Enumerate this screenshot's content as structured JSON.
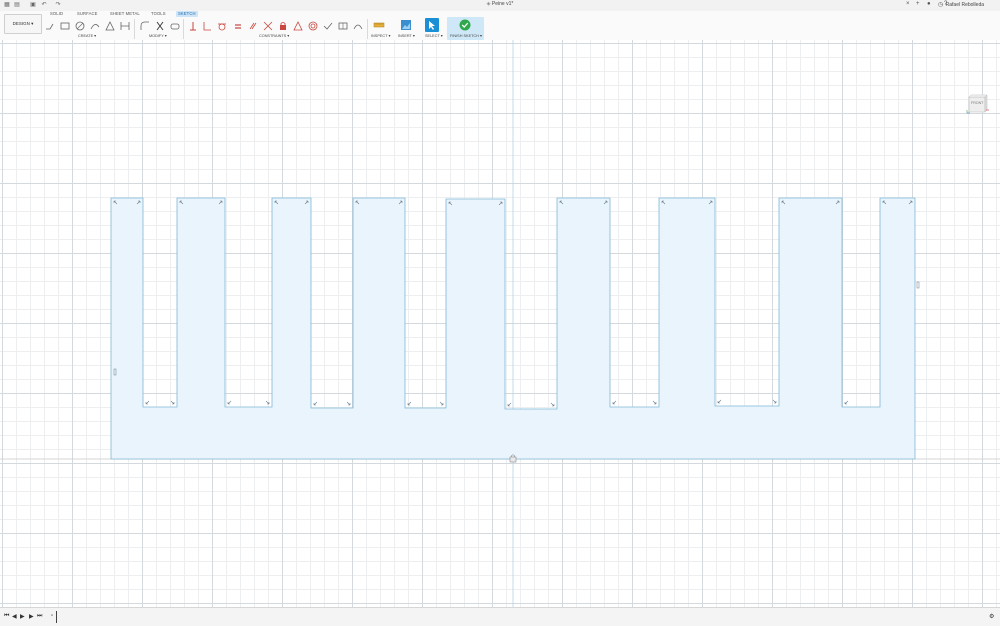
{
  "window": {
    "title": "Peine v1*"
  },
  "titlebar": {
    "user": "Rafael Rebolleda"
  },
  "toolbar": {
    "design_label": "DESIGN ▾",
    "tabs": [
      {
        "label": "SOLID"
      },
      {
        "label": "SURFACE"
      },
      {
        "label": "SHEET METAL"
      },
      {
        "label": "TOOLS"
      },
      {
        "label": "SKETCH"
      }
    ],
    "groups": {
      "create": "CREATE ▾",
      "modify": "MODIFY ▾",
      "constraints": "CONSTRAINTS ▾",
      "inspect": "INSPECT ▾",
      "insert": "INSERT ▾",
      "select": "SELECT ▾",
      "finish": "FINISH SKETCH ▾"
    }
  },
  "viewcube": {
    "face": "FRONT"
  },
  "colors": {
    "sketch_fill": "#eaf4fc",
    "sketch_line": "#7fb8d8",
    "accent": "#1a8fd6",
    "finish_green": "#2ea84b"
  }
}
